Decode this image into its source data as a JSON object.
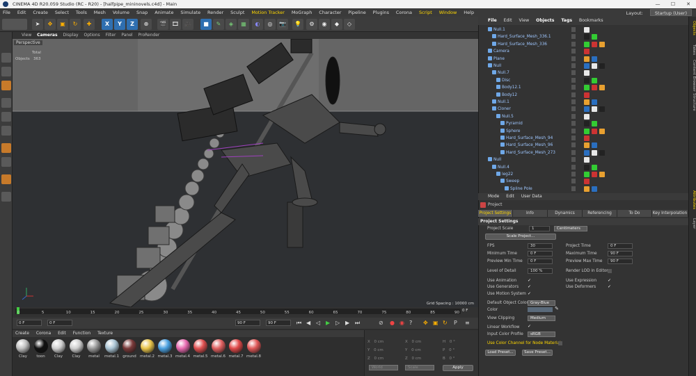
{
  "window": {
    "title": "CINEMA 4D R20.059 Studio (RC - R20) - [halfpipe_mininovels.c4d] - Main",
    "min": "—",
    "max": "☐",
    "close": "✕"
  },
  "menubar": {
    "items": [
      "File",
      "Edit",
      "Create",
      "Select",
      "Tools",
      "Mesh",
      "Volume",
      "Snap",
      "Animate",
      "Simulate",
      "Render",
      "Sculpt",
      "Motion Tracker",
      "MoGraph",
      "Character",
      "Pipeline",
      "Plugins",
      "Corona",
      "Script",
      "Window",
      "Help"
    ],
    "layout_label": "Layout:",
    "layout_value": "Startup (User)"
  },
  "toolbar": {
    "x": "X",
    "y": "Y",
    "z": "Z"
  },
  "viewport": {
    "menu": [
      "View",
      "Cameras",
      "Display",
      "Options",
      "Filter",
      "Panel",
      "ProRender"
    ],
    "camera": "Perspective",
    "stats_total": "Total",
    "stats_label": "Objects",
    "stats_value": "363",
    "grid_spacing": "Grid Spacing : 10000 cm"
  },
  "timeline": {
    "ticks": [
      "0",
      "5",
      "10",
      "15",
      "20",
      "25",
      "30",
      "35",
      "40",
      "45",
      "50",
      "55",
      "60",
      "65",
      "70",
      "75",
      "80",
      "85",
      "90"
    ],
    "end_frame": "0 F",
    "start_field": "0 F",
    "start2_field": "0 F",
    "end_field": "90 F",
    "end2_field": "90 F"
  },
  "materials": {
    "menu": [
      "Create",
      "Corona",
      "Edit",
      "Function",
      "Texture"
    ],
    "items": [
      {
        "label": "Clay",
        "color": "#bfbfbf"
      },
      {
        "label": "toon",
        "color": "#111111"
      },
      {
        "label": "Clay",
        "color": "#cfcfcf"
      },
      {
        "label": "Clay",
        "color": "#cfcfcf"
      },
      {
        "label": "metal",
        "color": "#9a9a9a"
      },
      {
        "label": "metal.1",
        "color": "#a9c4d4"
      },
      {
        "label": "ground",
        "color": "#7a3a3a"
      },
      {
        "label": "metal.2",
        "color": "#e8c44a"
      },
      {
        "label": "metal.3",
        "color": "#4aa0e0"
      },
      {
        "label": "metal.4",
        "color": "#e86ab0"
      },
      {
        "label": "metal.5",
        "color": "#e05050"
      },
      {
        "label": "metal.6",
        "color": "#e06060"
      },
      {
        "label": "metal.7",
        "color": "#e04848"
      },
      {
        "label": "metal.8",
        "color": "#e05858"
      }
    ]
  },
  "coords": {
    "x": "X",
    "y": "Y",
    "z": "Z",
    "zero": "0 cm",
    "hpb_h": "H",
    "hpb_p": "P",
    "hpb_b": "B",
    "deg": "0 °",
    "world": "World",
    "scale": "Scale",
    "apply": "Apply"
  },
  "object_manager": {
    "menu": [
      "File",
      "Edit",
      "View",
      "Objects",
      "Tags",
      "Bookmarks"
    ],
    "rows": [
      {
        "name": "Null.1",
        "indent": 0
      },
      {
        "name": "Hard_Surface_Mesh_336.1",
        "indent": 1
      },
      {
        "name": "Hard_Surface_Mesh_336",
        "indent": 1
      },
      {
        "name": "Camera",
        "indent": 0
      },
      {
        "name": "Plane",
        "indent": 0
      },
      {
        "name": "Null",
        "indent": 0
      },
      {
        "name": "Null.7",
        "indent": 1
      },
      {
        "name": "Disc",
        "indent": 2
      },
      {
        "name": "Body12.1",
        "indent": 2
      },
      {
        "name": "Body12",
        "indent": 2
      },
      {
        "name": "Null.1",
        "indent": 1
      },
      {
        "name": "Cloner",
        "indent": 1
      },
      {
        "name": "Null.5",
        "indent": 2
      },
      {
        "name": "Pyramid",
        "indent": 3
      },
      {
        "name": "Sphere",
        "indent": 3
      },
      {
        "name": "Hard_Surface_Mesh_94",
        "indent": 3
      },
      {
        "name": "Hard_Surface_Mesh_96",
        "indent": 3
      },
      {
        "name": "Hard_Surface_Mesh_273",
        "indent": 3
      },
      {
        "name": "Null",
        "indent": 0
      },
      {
        "name": "Null.4",
        "indent": 1
      },
      {
        "name": "leg22",
        "indent": 2
      },
      {
        "name": "Sweep",
        "indent": 3
      },
      {
        "name": "Spline Pole",
        "indent": 4
      }
    ]
  },
  "attributes": {
    "menu": [
      "Mode",
      "Edit",
      "User Data"
    ],
    "title": "Project",
    "tabs": [
      "Project Settings",
      "Info",
      "Dynamics",
      "Referencing",
      "To Do",
      "Key Interpolation"
    ],
    "section": "Project Settings",
    "project_scale_label": "Project Scale",
    "project_scale_value": "1",
    "project_scale_unit": "Centimeters",
    "scale_project_btn": "Scale Project...",
    "fps_label": "FPS",
    "fps_value": "30",
    "project_time_label": "Project Time",
    "project_time_value": "0 F",
    "min_time_label": "Minimum Time",
    "min_time_value": "0 F",
    "max_time_label": "Maximum Time",
    "max_time_value": "90 F",
    "prev_min_label": "Preview Min Time",
    "prev_min_value": "0 F",
    "prev_max_label": "Preview Max Time",
    "prev_max_value": "90 F",
    "lod_label": "Level of Detail",
    "lod_value": "100 %",
    "render_lod_label": "Render LOD in Editor",
    "use_anim_label": "Use Animation",
    "use_expr_label": "Use Expression",
    "use_gen_label": "Use Generators",
    "use_def_label": "Use Deformers",
    "use_motion_label": "Use Motion System",
    "default_color_label": "Default Object Color",
    "default_color_value": "Gray-Blue",
    "color_label": "Color",
    "view_clip_label": "View Clipping",
    "view_clip_value": "Medium",
    "linear_label": "Linear Workflow",
    "input_profile_label": "Input Color Profile",
    "input_profile_value": "sRGB",
    "node_mat_label": "Use Color Channel for Node Material",
    "load_preset": "Load Preset...",
    "save_preset": "Save Preset...",
    "check": "✓"
  },
  "sidetabs": [
    "Objects",
    "Takes",
    "Content Browser",
    "Structure",
    "Attributes",
    "Layer"
  ]
}
